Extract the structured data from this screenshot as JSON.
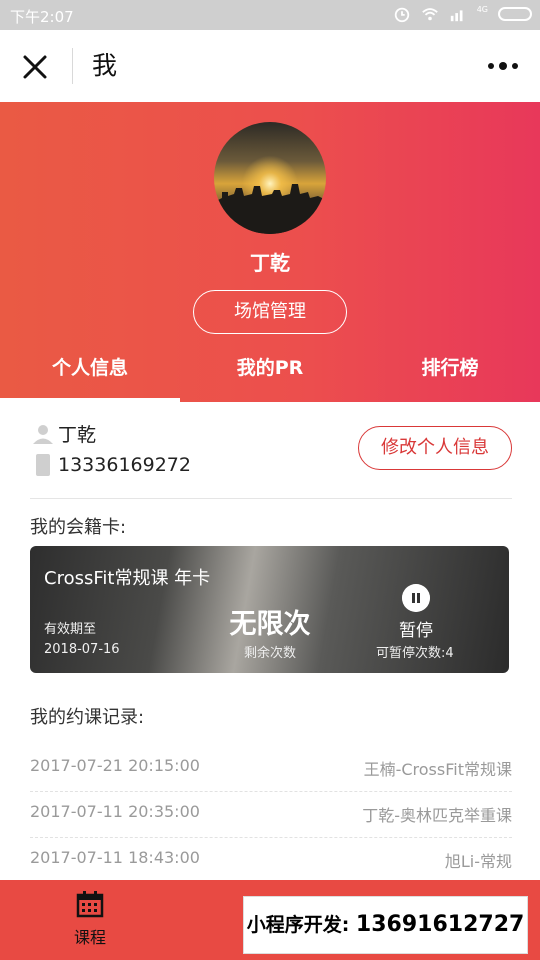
{
  "status_bar": {
    "time": "下午2:07",
    "network": "4G"
  },
  "nav": {
    "title": "我"
  },
  "profile": {
    "name": "丁乾",
    "venue_button": "场馆管理",
    "tabs": [
      {
        "label": "个人信息",
        "active": true
      },
      {
        "label": "我的PR",
        "active": false
      },
      {
        "label": "排行榜",
        "active": false
      }
    ],
    "info_name": "丁乾",
    "phone": "13336169272",
    "edit_button": "修改个人信息"
  },
  "membership": {
    "section_title": "我的会籍卡:",
    "card_title": "CrossFit常规课 年卡",
    "expiry_label": "有效期至",
    "expiry_date": "2018-07-16",
    "remaining_value": "无限次",
    "remaining_label": "剩余次数",
    "pause_label": "暂停",
    "pause_count": "可暂停次数:4"
  },
  "records": {
    "section_title": "我的约课记录:",
    "items": [
      {
        "time": "2017-07-21 20:15:00",
        "course": "王楠-CrossFit常规课"
      },
      {
        "time": "2017-07-11 20:35:00",
        "course": "丁乾-奥林匹克举重课"
      },
      {
        "time": "2017-07-11 18:43:00",
        "course": "旭Li-常规"
      }
    ]
  },
  "tabbar": {
    "course_label": "课程"
  },
  "promo": {
    "label": "小程序开发:",
    "phone": "13691612727"
  },
  "colors": {
    "accent": "#e84a43",
    "edit_border": "#d93838"
  }
}
